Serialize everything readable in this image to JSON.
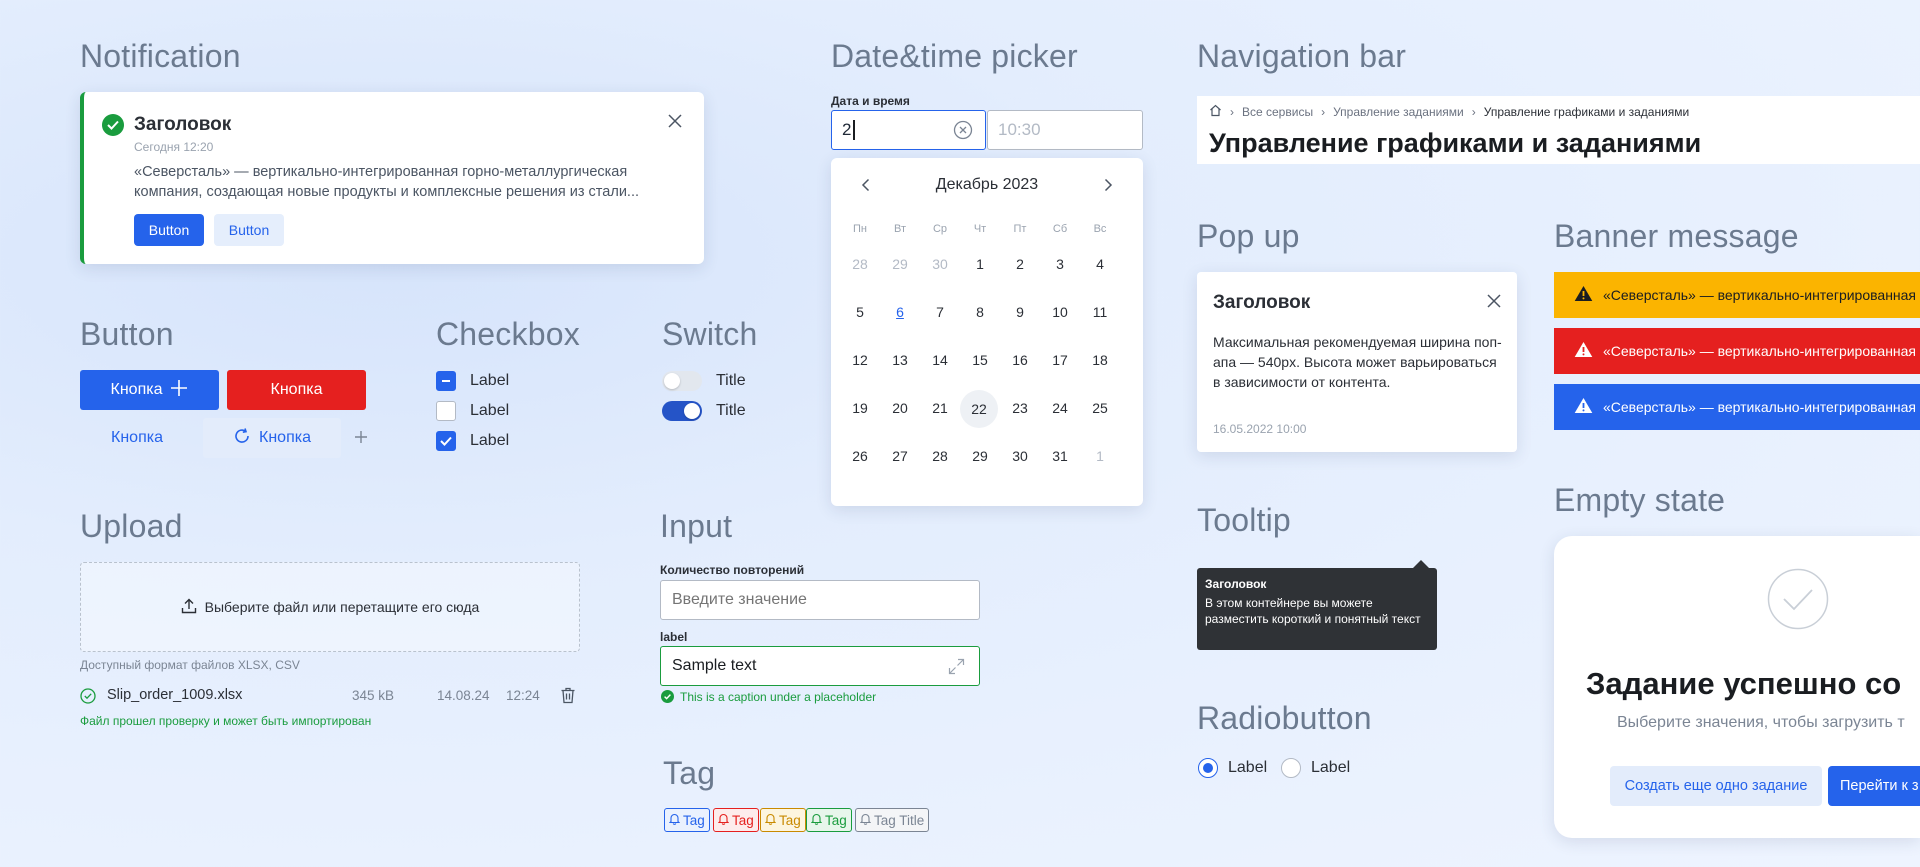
{
  "sections": {
    "notification": "Notification",
    "button": "Button",
    "checkbox": "Checkbox",
    "switch": "Switch",
    "upload": "Upload",
    "datetime": "Date&time picker",
    "input": "Input",
    "tag": "Tag",
    "navbar": "Navigation bar",
    "popup": "Pop up",
    "banner": "Banner message",
    "tooltip": "Tooltip",
    "radio": "Radiobutton",
    "empty": "Empty state"
  },
  "notification": {
    "title": "Заголовок",
    "time": "Сегодня 12:20",
    "text": "«Северсталь» — вертикально-интегрированная горно-металлургическая компания, создающая новые продукты и комплексные решения из стали...",
    "primary_button": "Button",
    "secondary_button": "Button"
  },
  "buttons": {
    "primary": "Кнопка",
    "danger": "Кнопка",
    "ghost": "Кнопка",
    "soft": "Кнопка"
  },
  "checkboxes": [
    {
      "label": "Label",
      "state": "indeterminate"
    },
    {
      "label": "Label",
      "state": "unchecked"
    },
    {
      "label": "Label",
      "state": "checked"
    }
  ],
  "switches": [
    {
      "label": "Title",
      "on": false
    },
    {
      "label": "Title",
      "on": true
    }
  ],
  "upload": {
    "dropzone_text": "Выберите файл или перетащите его сюда",
    "formats": "Доступный формат файлов XLSX, CSV",
    "file_name": "Slip_order_1009.xlsx",
    "file_size": "345 kB",
    "file_date": "14.08.24",
    "file_time": "12:24",
    "status": "Файл прошел проверку и может быть импортирован"
  },
  "datetime": {
    "label": "Дата и время",
    "date_value": "2",
    "time_placeholder": "10:30",
    "month": "Декабрь 2023",
    "weekdays": [
      "Пн",
      "Вт",
      "Ср",
      "Чт",
      "Пт",
      "Сб",
      "Вс"
    ],
    "weeks": [
      [
        "28",
        "29",
        "30",
        "1",
        "2",
        "3",
        "4"
      ],
      [
        "5",
        "6",
        "7",
        "8",
        "9",
        "10",
        "11"
      ],
      [
        "12",
        "13",
        "14",
        "15",
        "16",
        "17",
        "18"
      ],
      [
        "19",
        "20",
        "21",
        "22",
        "23",
        "24",
        "25"
      ],
      [
        "26",
        "27",
        "28",
        "29",
        "30",
        "31",
        "1"
      ]
    ]
  },
  "input": {
    "label1": "Количество повторений",
    "placeholder1": "Введите значение",
    "label2": "label",
    "value2": "Sample text",
    "caption": "This is a caption under a placeholder"
  },
  "tags": [
    {
      "label": "Tag",
      "color": "#2563eb",
      "bg": "#eaf1fe"
    },
    {
      "label": "Tag",
      "color": "#e5201f",
      "bg": "#fdecec"
    },
    {
      "label": "Tag",
      "color": "#c98a00",
      "bg": "#fdf5df"
    },
    {
      "label": "Tag",
      "color": "#1a9c3e",
      "bg": "#e7f6eb"
    },
    {
      "label": "Tag Title",
      "color": "#7b8594",
      "bg": "#f4f5f7"
    }
  ],
  "navbar": {
    "crumbs": [
      "Все сервисы",
      "Управление заданиями",
      "Управление графиками и заданиями"
    ],
    "title": "Управление графиками и заданиями"
  },
  "popup": {
    "title": "Заголовок",
    "text": "Максимальная рекомендуемая ширина поп-апа — 540px. Высота может варьироваться в зависимости от контента.",
    "date": "16.05.2022 10:00"
  },
  "banners": [
    {
      "text": "«Северсталь» — вертикально-интегрированная",
      "bg": "#fbb400",
      "fg": "#1a1d21",
      "icon_fill": "#1a1d21",
      "mark": "#fbb400"
    },
    {
      "text": "«Северсталь» — вертикально-интегрированная",
      "bg": "#e5201f",
      "fg": "#ffffff",
      "icon_fill": "#ffffff",
      "mark": "#e5201f"
    },
    {
      "text": "«Северсталь» — вертикально-интегрированная",
      "bg": "#2563eb",
      "fg": "#ffffff",
      "icon_fill": "#ffffff",
      "mark": "#2563eb"
    }
  ],
  "tooltip": {
    "title": "Заголовок",
    "text": "В этом контейнере вы можете разместить короткий и понятный текст"
  },
  "radios": [
    {
      "label": "Label",
      "checked": true
    },
    {
      "label": "Label",
      "checked": false
    }
  ],
  "empty_state": {
    "title": "Задание успешно со",
    "subtitle": "Выберите значения, чтобы загрузить т",
    "secondary_button": "Создать еще одно задание",
    "primary_button": "Перейти к з"
  },
  "colors": {
    "accent": "#2563eb",
    "success": "#1a9c3e",
    "danger": "#e5201f",
    "warning": "#fbb400"
  }
}
